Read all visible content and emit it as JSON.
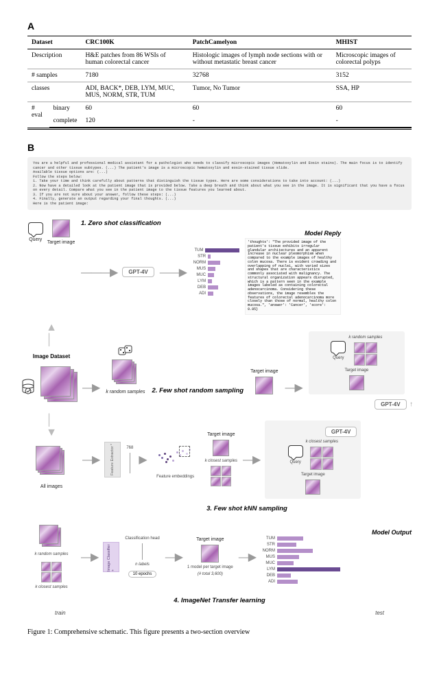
{
  "panelA_label": "A",
  "panelB_label": "B",
  "table": {
    "headers": {
      "dataset": "Dataset",
      "col1": "CRC100K",
      "col2": "PatchCamelyon",
      "col3": "MHIST"
    },
    "rows": {
      "description": {
        "label": "Description",
        "c1": "H&E patches from 86 WSIs of human colorectal cancer",
        "c2": "Histologic images of lymph node sections with or without metastatic breast cancer",
        "c3": "Microscopic images of colorectal polyps"
      },
      "nsamples": {
        "label": "# samples",
        "c1": "7180",
        "c2": "32768",
        "c3": "3152"
      },
      "classes": {
        "label": "classes",
        "c1": "ADI, BACK*, DEB, LYM, MUC, MUS, NORM, STR, TUM",
        "c2": "Tumor, No Tumor",
        "c3": "SSA, HP"
      },
      "neval_b": {
        "label": "# eval",
        "sublabel_b": "binary",
        "c1b": "60",
        "c2b": "60",
        "c3b": "60",
        "sublabel_c": "complete",
        "c1c": "120",
        "c2c": "-",
        "c3c": "-"
      }
    }
  },
  "prompt": "You are a helpful and professional medical assistant for a pathologist who needs to classify microscopic images (Hematoxylin and Eosin stains). The main focus is to identify cancer and other tissue subtypes. (...) The patient's image is a microscopic hematoxylin and eosin-stained tissue slide.\nAvailable tissue options are: (...)\nFollow the steps below:\n1. Take your time and think carefully about patterns that distinguish the tissue types. Here are some considerations to take into account: (...)\n2. Now have a detailed look at the patient image that is provided below. Take a deep breath and think about what you see in the image. It is significant that you have a focus on every detail. Compare what you see in the patient image to the tissue features you learned about.\n3. If you are not sure about your answer, follow these steps: (...)\n4. Finally, generate an output regarding your final thoughts. (...)\nHere is the patient image:",
  "labels": {
    "query": "Query",
    "target_image": "Target image",
    "gpt4v": "GPT-4V",
    "model_reply": "Model Reply",
    "image_dataset": "Image Dataset",
    "k_random": "k random samples",
    "k_closest": "k closest samples",
    "all_images": "All images",
    "feature_extractor": "Feature Extractor *",
    "feat_dim": "768",
    "feature_embeddings": "Feature embeddings",
    "image_classifier": "Image Classifier +",
    "clf_head": "Classification head",
    "n_labels": "n labels",
    "epochs": "10 epochs",
    "one_model": "1 model per target image",
    "n_total": "(# total 3,600)",
    "model_output": "Model Output",
    "train": "train",
    "test": "test",
    "sec1": "1. Zero shot classification",
    "sec2": "2. Few shot random sampling",
    "sec3": "3. Few shot kNN sampling",
    "sec4": "4. ImageNet Transfer learning"
  },
  "reply_text": "'thoughts': \"The provided image of the patient's tissue exhibits irregular glandular architectures and an apparent increase in nuclear pleomorphism when compared to the example images of healthy colon mucosa. There is evident crowding and overlapping of nuclei, with varied sizes and shapes that are characteristics commonly associated with malignancy. The structural organization appears disrupted, which is a pattern seen in the example images labeled as containing colorectal adenocarcinoma. Considering these observations, the image resembles the features of colorectal adenocarcinoma more closely than those of normal, healthy colon mucosa.\", 'answer': 'Cancer', 'score': 0.85}",
  "chart_data": [
    {
      "type": "bar",
      "orientation": "horizontal",
      "title": "Model Reply",
      "categories": [
        "TUM",
        "STR",
        "NORM",
        "MUS",
        "MUC",
        "LYM",
        "DEB",
        "ADI"
      ],
      "values": [
        85,
        5,
        25,
        15,
        12,
        8,
        20,
        10
      ],
      "highlight": [
        "TUM"
      ],
      "xlim": [
        0,
        100
      ]
    },
    {
      "type": "bar",
      "orientation": "horizontal",
      "title": "Model Output",
      "categories": [
        "TUM",
        "STR",
        "NORM",
        "MUS",
        "MUC",
        "LYM",
        "DEB",
        "ADI"
      ],
      "values": [
        35,
        25,
        48,
        30,
        22,
        85,
        18,
        28
      ],
      "highlight": [
        "LYM"
      ],
      "xlim": [
        0,
        100
      ]
    }
  ],
  "caption_prefix": "Figure 1: Comprehensive schematic. This figure presents ",
  "caption_rest": "a two-section overview"
}
